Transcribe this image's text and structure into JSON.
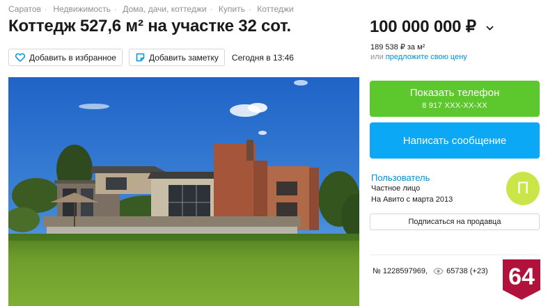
{
  "breadcrumb": [
    "Саратов",
    "Недвижимость",
    "Дома, дачи, коттеджи",
    "Купить",
    "Коттеджи"
  ],
  "listing": {
    "title": "Коттедж 527,6 м² на участке 32 сот.",
    "favorite_label": "Добавить в избранное",
    "note_label": "Добавить заметку",
    "published": "Сегодня в 13:46"
  },
  "price": {
    "amount": "100 000 000 ₽",
    "per_meter": "189 538 ₽ за м²",
    "offer_prefix": "или",
    "offer_link": "предложите свою цену"
  },
  "contact": {
    "phone_button": "Показать телефон",
    "phone_masked": "8 917 XXX-XX-XX",
    "message_button": "Написать сообщение"
  },
  "seller": {
    "name": "Пользователь",
    "type": "Частное лицо",
    "since": "На Авито с марта 2013",
    "avatar_letter": "П",
    "subscribe_button": "Подписаться на продавца"
  },
  "meta": {
    "ad_number": "№ 1228597969,",
    "views": "65738 (+23)"
  },
  "badge": {
    "text": "64",
    "color": "#b0123c"
  },
  "colors": {
    "phone_button": "#5cc82e",
    "message_button": "#0aa8f5",
    "link": "#0091d9",
    "avatar": "#c9e548"
  },
  "icons": {
    "favorite": "heart-icon",
    "note": "note-icon",
    "price_toggle": "chevron-down-icon",
    "views": "eye-icon"
  }
}
